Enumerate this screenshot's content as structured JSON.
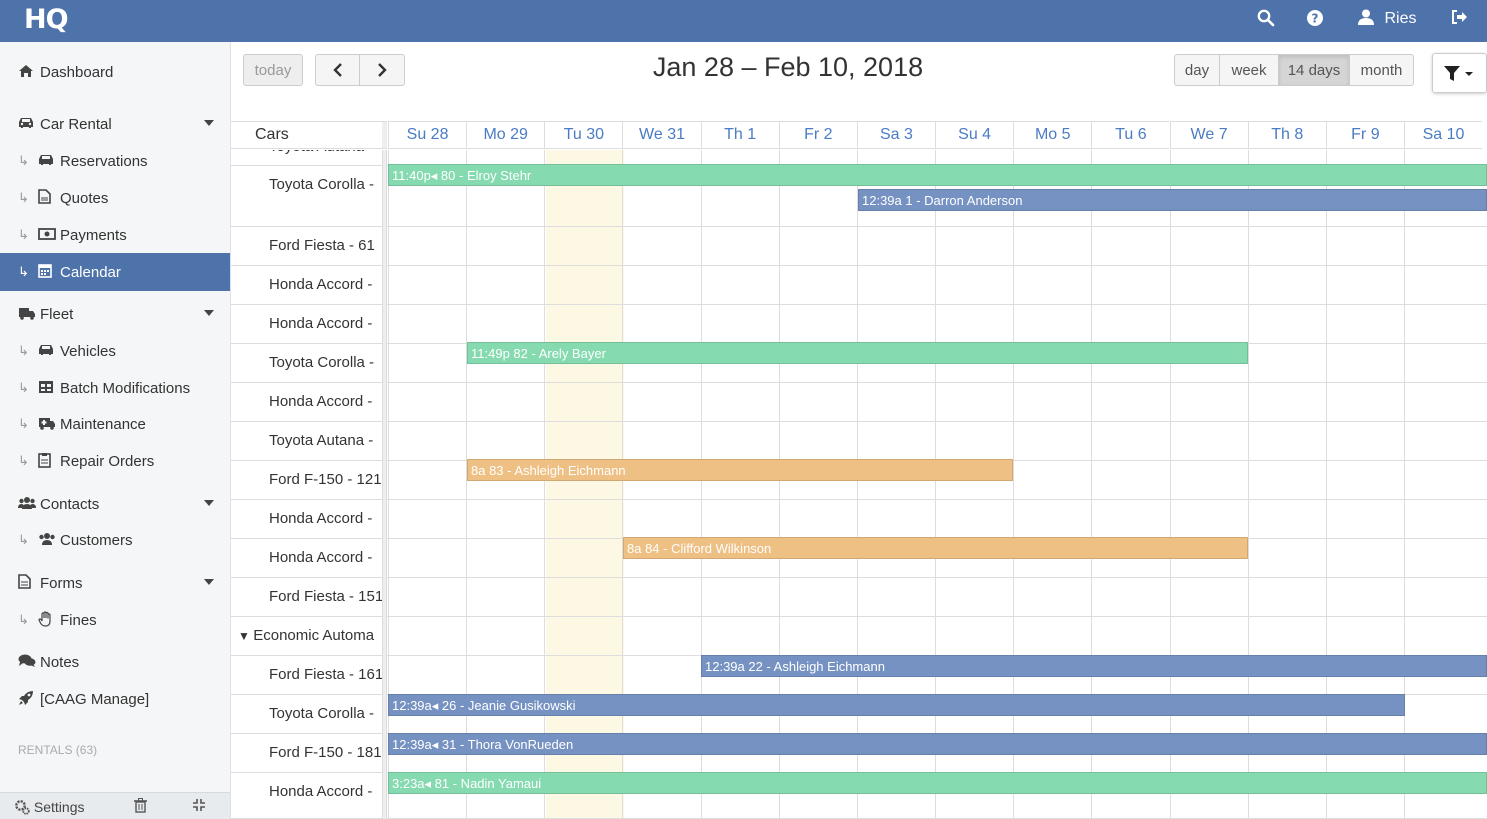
{
  "topbar": {
    "logo": "HQ",
    "user_name": "Ries",
    "icons": [
      "search-icon",
      "help-icon",
      "user-icon",
      "logout-icon"
    ]
  },
  "sidebar": {
    "items": [
      {
        "label": "Dashboard",
        "icon": "home-icon"
      },
      {
        "label": "Car Rental",
        "icon": "car-icon"
      },
      {
        "label": "Reservations",
        "icon": "car-icon"
      },
      {
        "label": "Quotes",
        "icon": "document-icon"
      },
      {
        "label": "Payments",
        "icon": "money-icon"
      },
      {
        "label": "Calendar",
        "icon": "calendar-icon"
      },
      {
        "label": "Fleet",
        "icon": "truck-icon"
      },
      {
        "label": "Vehicles",
        "icon": "car-icon"
      },
      {
        "label": "Batch Modifications",
        "icon": "table-icon"
      },
      {
        "label": "Maintenance",
        "icon": "ambulance-icon"
      },
      {
        "label": "Repair Orders",
        "icon": "clipboard-icon"
      },
      {
        "label": "Contacts",
        "icon": "users-icon"
      },
      {
        "label": "Customers",
        "icon": "users-icon"
      },
      {
        "label": "Forms",
        "icon": "file-icon"
      },
      {
        "label": "Fines",
        "icon": "hand-icon"
      },
      {
        "label": "Notes",
        "icon": "comments-icon"
      },
      {
        "label": "[CAAG Manage]",
        "icon": "rocket-icon"
      }
    ],
    "rentals_label": "RENTALS (63)",
    "footer": {
      "settings_label": "Settings"
    }
  },
  "toolbar": {
    "today_label": "today",
    "title": "Jan 28 – Feb 10, 2018",
    "views": [
      "day",
      "week",
      "14 days",
      "month"
    ],
    "active_view": "14 days"
  },
  "calendar": {
    "resource_header": "Cars",
    "days": [
      "Su 28",
      "Mo 29",
      "Tu 30",
      "We 31",
      "Th 1",
      "Fr 2",
      "Sa 3",
      "Su 4",
      "Mo 5",
      "Tu 6",
      "We 7",
      "Th 8",
      "Fr 9",
      "Sa 10"
    ],
    "today_day": "Tu 30",
    "rows": [
      {
        "label": "Toyota Autana"
      },
      {
        "label": "Toyota Corolla -"
      },
      {
        "label": "Ford Fiesta - 61"
      },
      {
        "label": "Honda Accord -"
      },
      {
        "label": "Honda Accord -"
      },
      {
        "label": "Toyota Corolla -"
      },
      {
        "label": "Honda Accord -"
      },
      {
        "label": "Toyota Autana -"
      },
      {
        "label": "Ford F-150 - 121"
      },
      {
        "label": "Honda Accord -"
      },
      {
        "label": "Honda Accord -"
      },
      {
        "label": "Ford Fiesta - 151"
      },
      {
        "label": "Economic Automa",
        "group": true
      },
      {
        "label": "Ford Fiesta - 161"
      },
      {
        "label": "Toyota Corolla -"
      },
      {
        "label": "Ford F-150 - 181"
      },
      {
        "label": "Honda Accord -"
      }
    ],
    "events": [
      {
        "text": "11:40p◂ 80 - Elroy Stehr",
        "color": "#85dab0"
      },
      {
        "text": "12:39a 1 - Darron Anderson",
        "color": "#7592c2"
      },
      {
        "text": "11:49p 82 - Arely Bayer",
        "color": "#85dab0"
      },
      {
        "text": "8a 83 - Ashleigh Eichmann",
        "color": "#eec083"
      },
      {
        "text": "8a 84 - Clifford Wilkinson",
        "color": "#eec083"
      },
      {
        "text": "12:39a 22 - Ashleigh Eichmann",
        "color": "#7592c2"
      },
      {
        "text": "12:39a◂ 26 - Jeanie Gusikowski",
        "color": "#7592c2"
      },
      {
        "text": "12:39a◂ 31 - Thora VonRueden",
        "color": "#7592c2"
      },
      {
        "text": "3:23a◂ 81 - Nadin Yamaui",
        "color": "#85dab0"
      }
    ]
  },
  "colors": {
    "brand": "#4e72aa",
    "today_highlight": "#fcf8e3"
  }
}
